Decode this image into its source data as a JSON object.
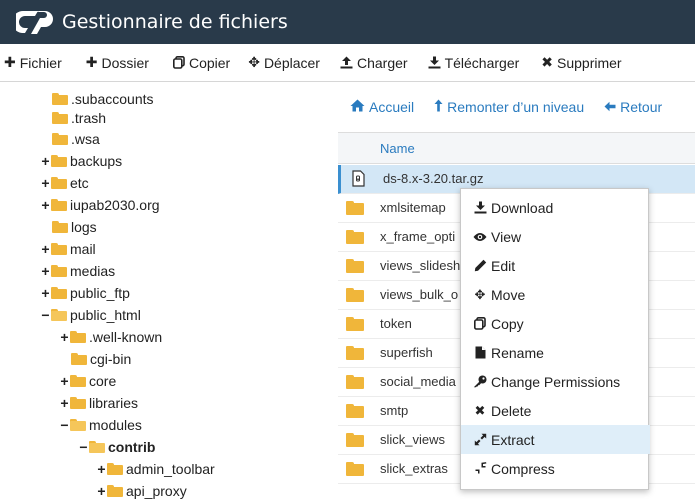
{
  "header": {
    "logo": "cP",
    "title": "Gestionnaire de fichiers"
  },
  "toolbar": {
    "items": [
      {
        "label": "Fichier",
        "icon": "plus-icon"
      },
      {
        "label": "Dossier",
        "icon": "plus-icon"
      },
      {
        "label": "Copier",
        "icon": "copy-icon"
      },
      {
        "label": "Déplacer",
        "icon": "move-icon"
      },
      {
        "label": "Charger",
        "icon": "upload-icon"
      },
      {
        "label": "Télécharger",
        "icon": "download-icon"
      },
      {
        "label": "Supprimer",
        "icon": "x-icon"
      }
    ]
  },
  "tree": {
    "items": [
      {
        "label": ".subaccounts",
        "expander": ""
      },
      {
        "label": ".trash",
        "expander": ""
      },
      {
        "label": ".wsa",
        "expander": ""
      },
      {
        "label": "backups",
        "expander": "+"
      },
      {
        "label": "etc",
        "expander": "+"
      },
      {
        "label": "iupab2030.org",
        "expander": "+"
      },
      {
        "label": "logs",
        "expander": ""
      },
      {
        "label": "mail",
        "expander": "+"
      },
      {
        "label": "medias",
        "expander": "+"
      },
      {
        "label": "public_ftp",
        "expander": "+"
      },
      {
        "label": "public_html",
        "expander": "−"
      },
      {
        "label": ".well-known",
        "expander": "+"
      },
      {
        "label": "cgi-bin",
        "expander": ""
      },
      {
        "label": "core",
        "expander": "+"
      },
      {
        "label": "libraries",
        "expander": "+"
      },
      {
        "label": "modules",
        "expander": "−"
      },
      {
        "label": "contrib",
        "expander": "−"
      },
      {
        "label": "admin_toolbar",
        "expander": "+"
      },
      {
        "label": "api_proxy",
        "expander": "+"
      }
    ]
  },
  "nav": {
    "home": "Accueil",
    "up": "Remonter d’un niveau",
    "back": "Retour"
  },
  "table": {
    "column_name": "Name",
    "rows": [
      {
        "name": "ds-8.x-3.20.tar.gz",
        "type": "archive"
      },
      {
        "name": "xmlsitemap",
        "type": "folder"
      },
      {
        "name": "x_frame_opti",
        "type": "folder"
      },
      {
        "name": "views_slidesh",
        "type": "folder"
      },
      {
        "name": "views_bulk_o",
        "type": "folder"
      },
      {
        "name": "token",
        "type": "folder"
      },
      {
        "name": "superfish",
        "type": "folder"
      },
      {
        "name": "social_media",
        "type": "folder"
      },
      {
        "name": "smtp",
        "type": "folder"
      },
      {
        "name": "slick_views",
        "type": "folder"
      },
      {
        "name": "slick_extras",
        "type": "folder"
      }
    ]
  },
  "context_menu": {
    "items": [
      {
        "label": "Download",
        "icon": "download-icon"
      },
      {
        "label": "View",
        "icon": "eye-icon"
      },
      {
        "label": "Edit",
        "icon": "pencil-icon"
      },
      {
        "label": "Move",
        "icon": "move-icon"
      },
      {
        "label": "Copy",
        "icon": "copy-icon"
      },
      {
        "label": "Rename",
        "icon": "file-icon"
      },
      {
        "label": "Change Permissions",
        "icon": "key-icon"
      },
      {
        "label": "Delete",
        "icon": "x-icon"
      },
      {
        "label": "Extract",
        "icon": "expand-icon"
      },
      {
        "label": "Compress",
        "icon": "compress-icon"
      }
    ]
  },
  "colors": {
    "header_bg": "#293a4a",
    "link": "#2a7bbf",
    "folder": "#f0b63a",
    "selected_row": "#d3e7f6",
    "menu_hover": "#dfeef9"
  }
}
